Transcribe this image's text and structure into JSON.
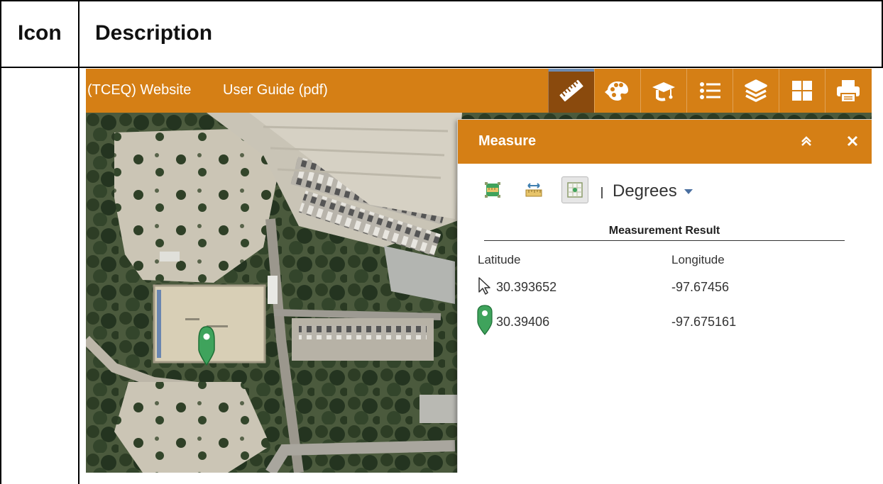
{
  "table": {
    "header_icon": "Icon",
    "header_description": "Description"
  },
  "screenshot": {
    "links": [
      "(TCEQ) Website",
      "User Guide (pdf)"
    ],
    "toolbar": [
      {
        "icon": "ruler-icon",
        "active": true
      },
      {
        "icon": "palette-icon",
        "active": false
      },
      {
        "icon": "graduation-cap-icon",
        "active": false
      },
      {
        "icon": "list-icon",
        "active": false
      },
      {
        "icon": "layers-icon",
        "active": false
      },
      {
        "icon": "grid-icon",
        "active": false
      },
      {
        "icon": "print-icon",
        "active": false
      }
    ],
    "panel": {
      "title": "Measure",
      "tools": [
        "area-tool-icon",
        "distance-tool-icon",
        "location-tool-icon"
      ],
      "selected_tool": "location-tool-icon",
      "unit": "Degrees",
      "result_title": "Measurement Result",
      "col_lat": "Latitude",
      "col_lon": "Longitude",
      "rows": [
        {
          "icon": "cursor-icon",
          "lat": "30.393652",
          "lon": "-97.67456"
        },
        {
          "icon": "location-pin-icon",
          "lat": "30.39406",
          "lon": "-97.675161"
        }
      ]
    },
    "colors": {
      "accent": "#d57f15",
      "active_button": "#8a4a0d",
      "pin": "#3fa35c"
    }
  }
}
